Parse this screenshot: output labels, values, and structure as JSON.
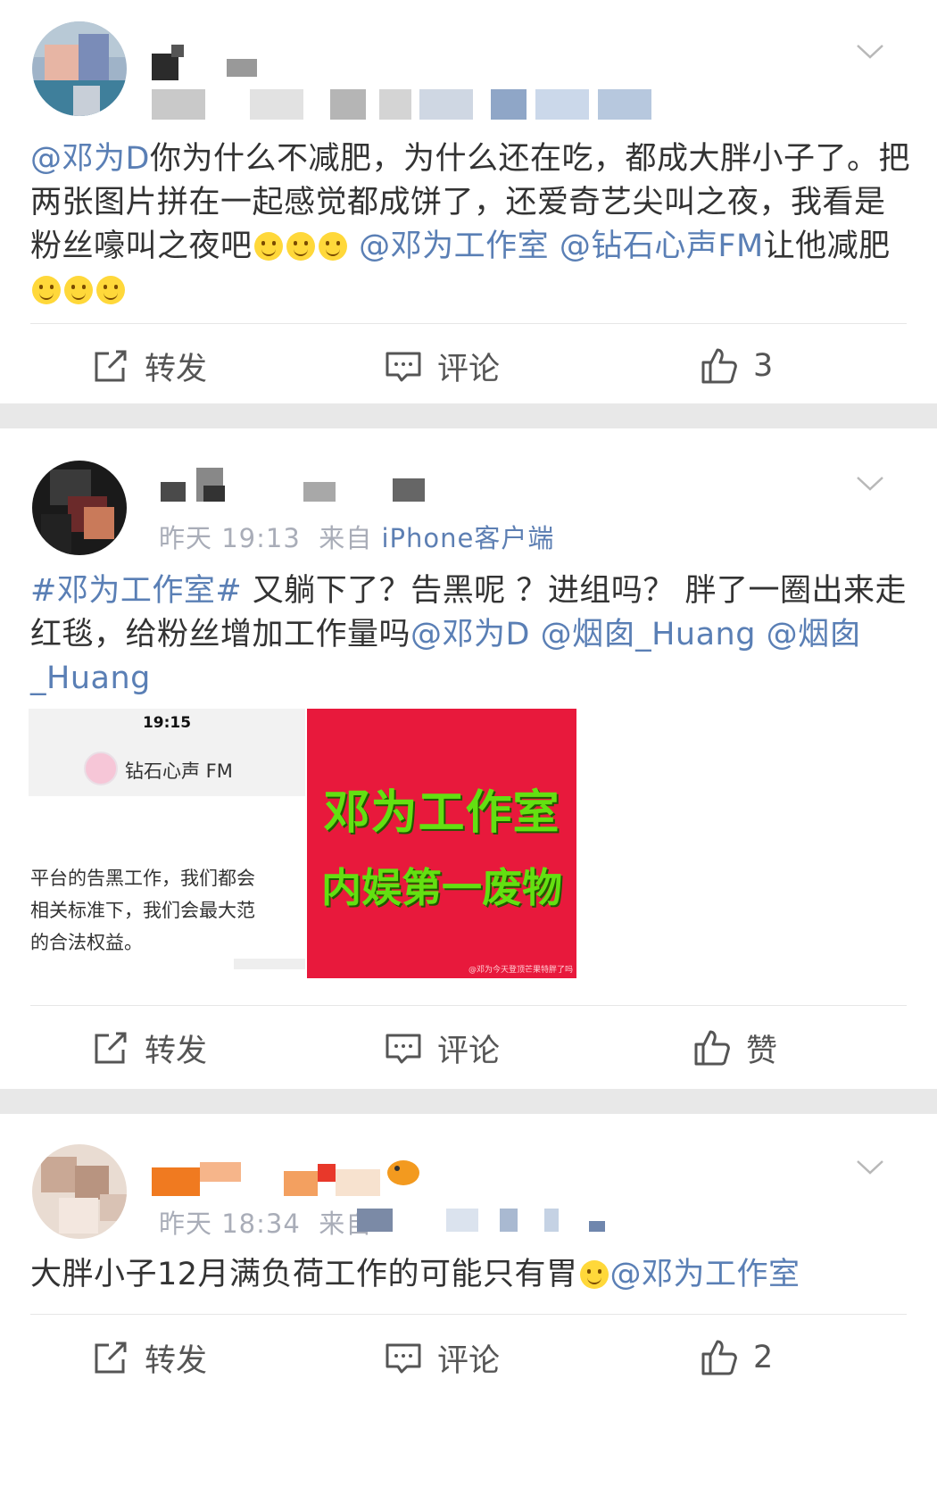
{
  "posts": [
    {
      "meta_time": "",
      "meta_client": "",
      "text_mention_1": "@邓为D",
      "text_body_1": "你为什么不减肥，为什么还在吃，都成大胖小子了。把两张图片拼在一起感觉都成饼了，还爱奇艺尖叫之夜，我看是粉丝嚎叫之夜吧",
      "text_mention_2": "@邓为工作室",
      "text_mention_3": "@钻石心声FM",
      "text_body_2": "让他减肥",
      "repost_label": "转发",
      "comment_label": "评论",
      "like_label": "3"
    },
    {
      "meta_time": "昨天 19:13",
      "meta_source": "来自",
      "meta_client": "iPhone客户端",
      "text_topic": "#邓为工作室#",
      "text_body_1": " 又躺下了？告黑呢 ？进组吗？ 胖了一圈出来走红毯，给粉丝增加工作量吗",
      "text_mention_1": "@邓为D",
      "text_mention_2": "@烟囱_Huang",
      "text_mention_3": "@烟囱_Huang",
      "image_left": {
        "status_time": "19:15",
        "account_name": "钻石心声 FM",
        "body_line_1": "平台的告黑工作，我们都会",
        "body_line_2": "相关标准下，我们会最大范",
        "body_line_3": "的合法权益。"
      },
      "image_right": {
        "line_1": "邓为工作室",
        "line_2": "内娱第一废物",
        "watermark": "@邓为今天登顶芒果特胖了吗"
      },
      "repost_label": "转发",
      "comment_label": "评论",
      "like_label": "赞"
    },
    {
      "meta_time": "昨天 18:34",
      "meta_source": "来自",
      "text_body_1": "大胖小子12月满负荷工作的可能只有胃",
      "text_mention_1": "@邓为工作室",
      "repost_label": "转发",
      "comment_label": "评论",
      "like_label": "2"
    }
  ],
  "colors": {
    "link": "#5a7fb5",
    "body_text": "#333333",
    "gap": "#e8e8e8",
    "promo_red": "#e8193c",
    "promo_green": "#63e011"
  },
  "icons": {
    "repost": "repost-icon",
    "comment": "comment-icon",
    "like": "thumbs-up-icon",
    "more": "chevron-down-icon"
  }
}
